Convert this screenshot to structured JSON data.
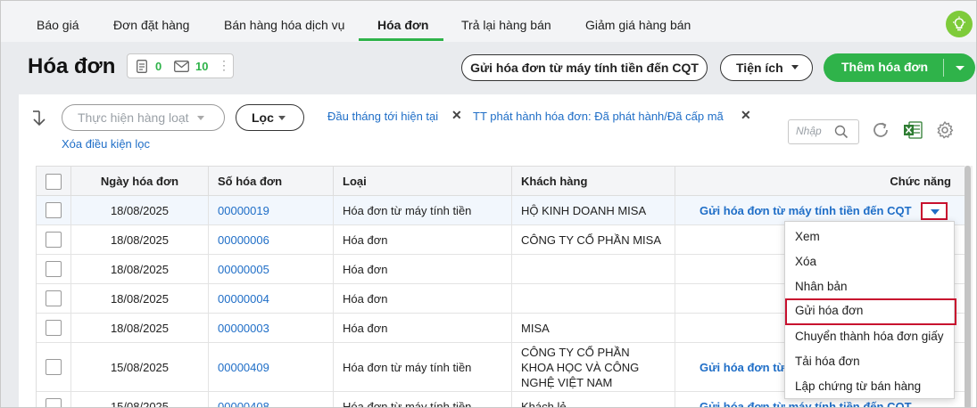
{
  "tabs": [
    {
      "label": "Báo giá"
    },
    {
      "label": "Đơn đặt hàng"
    },
    {
      "label": "Bán hàng hóa dịch vụ"
    },
    {
      "label": "Hóa đơn"
    },
    {
      "label": "Trả lại hàng bán"
    },
    {
      "label": "Giảm giá hàng bán"
    }
  ],
  "active_tab": "Hóa đơn",
  "header": {
    "title": "Hóa đơn",
    "count_docs": "0",
    "count_mail": "10",
    "more": "⋮",
    "send_cqt_label": "Gửi hóa đơn từ máy tính tiền đến CQT",
    "utilities_label": "Tiện ích",
    "add_label": "Thêm hóa đơn"
  },
  "filters": {
    "bulk_placeholder": "Thực hiện hàng loạt",
    "filter_label": "Lọc",
    "chip1": "Đầu tháng tới hiện tại",
    "chip2": "TT phát hành hóa đơn: Đã phát hành/Đã cấp mã",
    "clear_label": "Xóa điều kiện lọc",
    "search_placeholder": "Nhập",
    "close_glyph": "✕"
  },
  "table": {
    "headers": {
      "date": "Ngày hóa đơn",
      "number": "Số hóa đơn",
      "type": "Loại",
      "customer": "Khách hàng",
      "actions": "Chức năng"
    },
    "rows": [
      {
        "date": "18/08/2025",
        "number": "00000019",
        "type": "Hóa đơn từ máy tính tiền",
        "customer": "HỘ KINH DOANH MISA",
        "action": "Gửi hóa đơn từ máy tính tiền đến CQT"
      },
      {
        "date": "18/08/2025",
        "number": "00000006",
        "type": "Hóa đơn",
        "customer": "CÔNG TY CỔ PHẦN MISA",
        "action": ""
      },
      {
        "date": "18/08/2025",
        "number": "00000005",
        "type": "Hóa đơn",
        "customer": "",
        "action": ""
      },
      {
        "date": "18/08/2025",
        "number": "00000004",
        "type": "Hóa đơn",
        "customer": "",
        "action": ""
      },
      {
        "date": "18/08/2025",
        "number": "00000003",
        "type": "Hóa đơn",
        "customer": "MISA",
        "action": ""
      },
      {
        "date": "15/08/2025",
        "number": "00000409",
        "type": "Hóa đơn từ máy tính tiền",
        "customer": "CÔNG TY CỔ PHẦN KHOA HỌC VÀ CÔNG NGHỆ VIỆT NAM",
        "action": "Gửi hóa đơn từ"
      },
      {
        "date": "15/08/2025",
        "number": "00000408",
        "type": "Hóa đơn từ máy tính tiền",
        "customer": "Khách lẻ",
        "action": "Gửi hóa đơn từ máy tính tiền đến CQT"
      }
    ]
  },
  "menu": [
    {
      "label": "Xem"
    },
    {
      "label": "Xóa"
    },
    {
      "label": "Nhân bản"
    },
    {
      "label": "Gửi hóa đơn"
    },
    {
      "label": "Chuyển thành hóa đơn giấy"
    },
    {
      "label": "Tải hóa đơn"
    },
    {
      "label": "Lập chứng từ bán hàng"
    }
  ],
  "colors": {
    "accent_green": "#2fb34a",
    "link_blue": "#1f6ec7",
    "highlight_red": "#c8102e"
  }
}
